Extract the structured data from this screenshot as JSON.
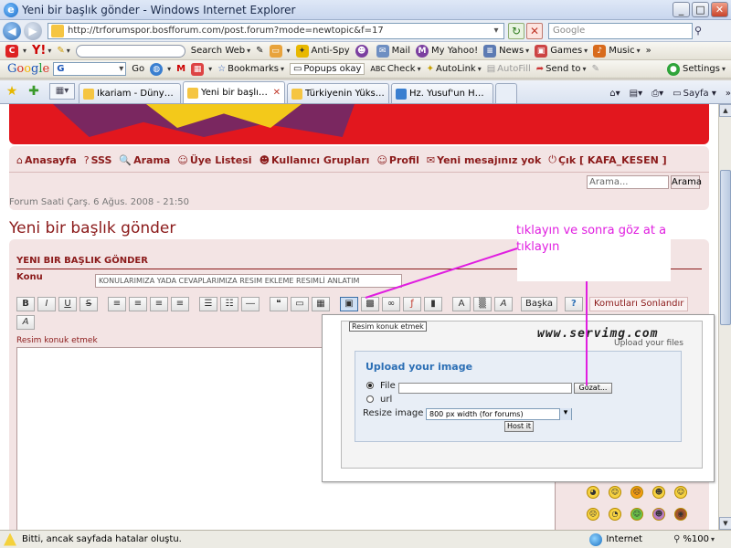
{
  "window": {
    "title": "Yeni bir başlık gönder - Windows Internet Explorer",
    "minimize": "_",
    "maximize": "□",
    "close": "✕"
  },
  "address": {
    "url": "http://trforumspor.bosfforum.com/post.forum?mode=newtopic&f=17",
    "search_placeholder": "Google"
  },
  "toolbar1": {
    "y_logo": "Y!",
    "search_web": "Search Web",
    "anti_spy": "Anti-Spy",
    "mail": "Mail",
    "my_yahoo": "My Yahoo!",
    "news": "News",
    "games": "Games",
    "music": "Music"
  },
  "toolbar2": {
    "google": "Google",
    "g_select": "G",
    "go": "Go",
    "bookmarks": "Bookmarks",
    "popups": "Popups okay",
    "check": "Check",
    "autolink": "AutoLink",
    "autofill": "AutoFill",
    "send_to": "Send to",
    "settings": "Settings"
  },
  "tabs": [
    {
      "label": "Ikariam - Dünya Beta"
    },
    {
      "label": "Yeni bir başlık gönder",
      "active": true
    },
    {
      "label": "Türkiyenin Yükselen fo..."
    },
    {
      "label": "Hz. Yusuf'un Hayatı, P..."
    }
  ],
  "tab_tools": {
    "page": "Sayfa"
  },
  "nav": {
    "items": [
      {
        "icon": "⌂",
        "label": "Anasayfa"
      },
      {
        "icon": "?",
        "label": "SSS"
      },
      {
        "icon": "🔍",
        "label": "Arama"
      },
      {
        "icon": "☺",
        "label": "Üye Listesi"
      },
      {
        "icon": "☻",
        "label": "Kullanıcı Grupları"
      },
      {
        "icon": "☺",
        "label": "Profil"
      },
      {
        "icon": "✉",
        "label": "Yeni mesajınız yok"
      },
      {
        "icon": "⏻",
        "label": "Çık [ KAFA_KESEN ]"
      }
    ],
    "search_placeholder": "Arama...",
    "search_button": "Arama"
  },
  "forum_time": "Forum Saati Çarş. 6 Ağus. 2008 - 21:50",
  "page_title": "Yeni bir başlık gönder",
  "post": {
    "box_title": "YENI BIR BAŞLIK GÖNDER",
    "subject_label": "Konu",
    "subject_value": "KONULARIMIZA YADA CEVAPLARIMIZA RESIM EKLEME RESIMLİ ANLATIM",
    "editor_buttons": {
      "bold": "B",
      "italic": "I",
      "underline": "U",
      "strike": "S",
      "more": "Başka",
      "help": "?",
      "end_commands": "Komutları Sonlandır",
      "font": "A"
    },
    "editor_label": "Resim konuk etmek"
  },
  "popup": {
    "tag": "Resim konuk etmek",
    "logo": "www.servimg.com",
    "tagline": "Upload your files",
    "title": "Upload your image",
    "file_label": "File",
    "url_label": "url",
    "browse": "Gözat...",
    "resize_label": "Resize image",
    "resize_value": "800 px width (for forums)",
    "host_button": "Host it"
  },
  "annotation": {
    "text": "tıklayın ve sonra göz at a tıklayın",
    "color": "#e01ee0"
  },
  "status": {
    "text": "Bitti, ancak sayfada hatalar oluştu.",
    "zone": "Internet",
    "zoom": "%100"
  }
}
